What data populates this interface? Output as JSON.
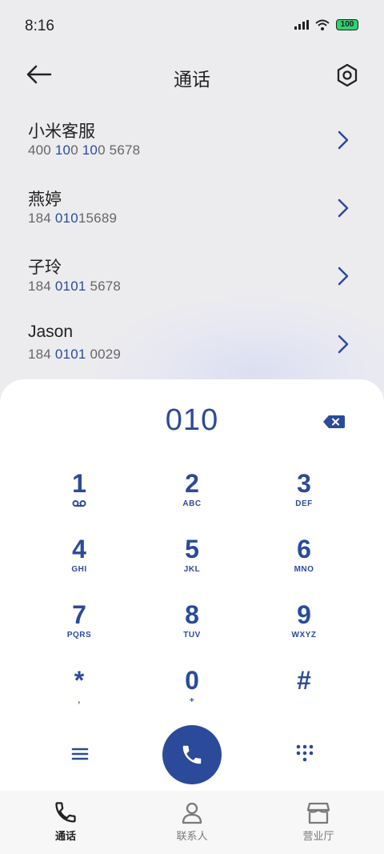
{
  "status_bar": {
    "time": "8:16",
    "battery": "100"
  },
  "header": {
    "title": "通话"
  },
  "contacts": [
    {
      "name": "小米客服",
      "phone_parts": [
        "400 ",
        "10",
        "0 ",
        "10",
        "0 5678"
      ]
    },
    {
      "name": "燕婷",
      "phone_parts": [
        "184 ",
        "010",
        "15689"
      ]
    },
    {
      "name": "子玲",
      "phone_parts": [
        "184 ",
        "0101",
        " 5678"
      ]
    },
    {
      "name": "Jason",
      "phone_parts": [
        "184 ",
        "0101",
        " 0029"
      ]
    }
  ],
  "dialer": {
    "number": "010",
    "keys": [
      {
        "digit": "1",
        "sub": "voicemail-icon"
      },
      {
        "digit": "2",
        "sub": "ABC"
      },
      {
        "digit": "3",
        "sub": "DEF"
      },
      {
        "digit": "4",
        "sub": "GHI"
      },
      {
        "digit": "5",
        "sub": "JKL"
      },
      {
        "digit": "6",
        "sub": "MNO"
      },
      {
        "digit": "7",
        "sub": "PQRS"
      },
      {
        "digit": "8",
        "sub": "TUV"
      },
      {
        "digit": "9",
        "sub": "WXYZ"
      },
      {
        "digit": "*",
        "sub": ","
      },
      {
        "digit": "0",
        "sub": "+"
      },
      {
        "digit": "#",
        "sub": ""
      }
    ]
  },
  "tabs": [
    {
      "label": "通话",
      "active": true,
      "icon": "phone-icon"
    },
    {
      "label": "联系人",
      "active": false,
      "icon": "person-icon"
    },
    {
      "label": "营业厅",
      "active": false,
      "icon": "store-icon"
    }
  ],
  "colors": {
    "accent": "#2b4a9a",
    "background": "#ececee"
  }
}
